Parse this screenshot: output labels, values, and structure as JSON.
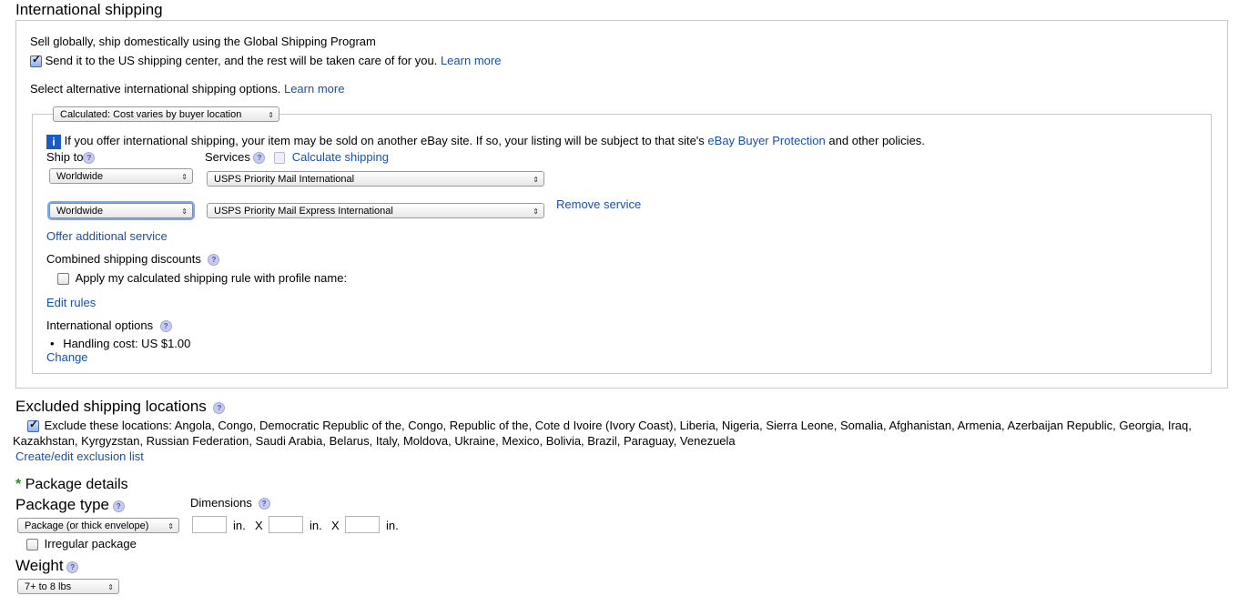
{
  "intl": {
    "title": "International shipping",
    "gsp_text": "Sell globally, ship domestically using the Global Shipping Program",
    "gsp_check_label": "Send it to the US shipping center, and the rest will be taken care of for you.",
    "learn_more": "Learn more",
    "alt_options_text": "Select alternative international shipping options.",
    "cost_type": "Calculated: Cost varies by buyer location",
    "info_text": "If you offer international shipping, your item may be sold on another eBay site. If so, your listing will be subject to that site's",
    "buyer_protection": "eBay Buyer Protection",
    "info_tail": "and other policies.",
    "ship_to_label": "Ship to",
    "services_label": "Services",
    "calc_shipping": "Calculate shipping",
    "rows": [
      {
        "ship_to": "Worldwide",
        "service": "USPS Priority Mail International"
      },
      {
        "ship_to": "Worldwide",
        "service": "USPS Priority Mail Express International"
      }
    ],
    "remove_service": "Remove service",
    "offer_additional": "Offer additional service",
    "combined_label": "Combined shipping discounts",
    "apply_rule": "Apply my calculated shipping rule with profile name:",
    "edit_rules": "Edit rules",
    "intl_options_label": "International options",
    "handling_cost": "Handling cost: US $1.00",
    "change": "Change"
  },
  "excluded": {
    "title": "Excluded shipping locations",
    "line1": "Exclude these locations: Angola, Congo, Democratic Republic of the, Congo, Republic of the, Cote d Ivoire (Ivory Coast), Liberia, Nigeria, Sierra Leone, Somalia, Afghanistan, Armenia, Azerbaijan Republic, Georgia, Iraq,",
    "line2": "Kazakhstan, Kyrgyzstan, Russian Federation, Saudi Arabia, Belarus, Italy, Moldova, Ukraine, Mexico, Bolivia, Brazil, Paraguay, Venezuela",
    "edit_link": "Create/edit exclusion list"
  },
  "package": {
    "required_mark": "*",
    "title": "Package details",
    "type_label": "Package type",
    "dimensions_label": "Dimensions",
    "type_value": "Package (or thick envelope)",
    "unit": "in.",
    "times": "X",
    "irregular": "Irregular package",
    "weight_label": "Weight",
    "weight_value": "7+ to 8 lbs"
  },
  "help_glyph": "?",
  "info_glyph": "i",
  "arrow_glyph": "⇕",
  "colors": {
    "link": "#1a4fa8",
    "required": "#2e8b2e",
    "info": "#1d5bc4"
  }
}
